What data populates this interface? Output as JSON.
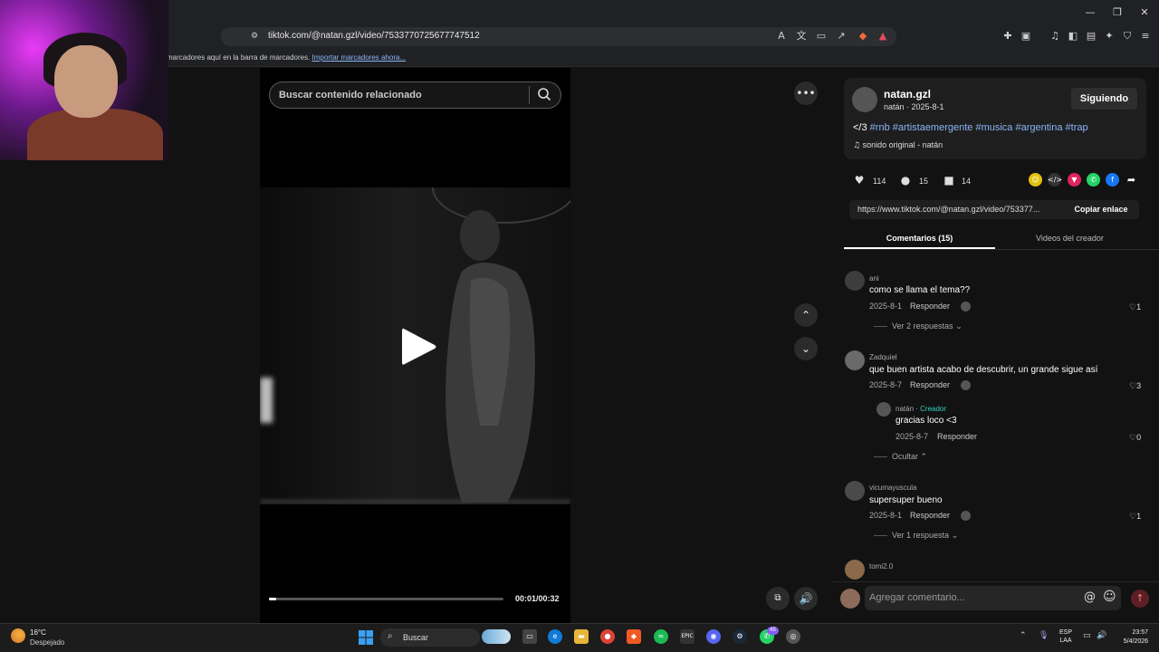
{
  "browser": {
    "url": "tiktok.com/@natan.gzl/video/7533770725677747512",
    "bookmarks_text": "marcadores aquí en la barra de marcadores.",
    "bookmarks_link": "Importar marcadores ahora..."
  },
  "video": {
    "search_placeholder": "Buscar contenido relacionado",
    "time": "00:01/00:32",
    "progress": 0.03
  },
  "author": {
    "name": "natan.gzl",
    "subtitle": "natán · 2025-8-1",
    "follow_label": "Siguiendo"
  },
  "caption": {
    "prefix": "</3",
    "hashtags": "#rnb #artistaemergente #musica #argentina #trap"
  },
  "sound": "sonido original - natán",
  "stats": {
    "likes": "114",
    "comments": "15",
    "saves": "14"
  },
  "link": {
    "url": "https://www.tiktok.com/@natan.gzl/video/753377...",
    "copy_label": "Copiar enlace"
  },
  "tabs": {
    "comments": "Comentarios (15)",
    "creator": "Videos del creador"
  },
  "comments": [
    {
      "user": "ani",
      "text": "como se llama el tema??",
      "date": "2025-8-1",
      "reply": "Responder",
      "likes": "1",
      "more": "Ver 2 respuestas"
    },
    {
      "user": "Zadquiel",
      "text": "que buen artista acabo de descubrir, un grande sigue así",
      "date": "2025-8-7",
      "reply": "Responder",
      "likes": "3",
      "more": "Ocultar"
    },
    {
      "user": "vicumayuscula",
      "text": "supersuper bueno",
      "date": "2025-8-1",
      "reply": "Responder",
      "likes": "1",
      "more": "Ver 1 respuesta"
    },
    {
      "user": "tomi2.0"
    }
  ],
  "reply": {
    "user": "natán",
    "tag": "Creador",
    "text": "gracias loco <3",
    "date": "2025-8-7",
    "reply": "Responder",
    "likes": "0"
  },
  "comment_input_placeholder": "Agregar comentario...",
  "taskbar": {
    "temp": "16°C",
    "weather": "Despejado",
    "search": "Buscar",
    "lang_top": "ESP",
    "lang_bottom": "LAA",
    "time": "23:57",
    "date": "5/4/2026",
    "badge": "45"
  },
  "colors": {
    "accent_link": "#8ab4f8",
    "creator_tag": "#2dd4bf",
    "send_button": "#5c1f26"
  }
}
